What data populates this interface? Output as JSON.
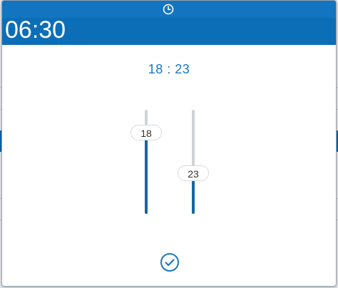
{
  "header": {
    "clock_icon": "clock-icon",
    "time": "06:30"
  },
  "picker": {
    "selected_time": "18 : 23",
    "hour": {
      "label": "18",
      "value": 18,
      "max": 23
    },
    "minute": {
      "label": "23",
      "value": 23,
      "max": 59
    }
  },
  "confirm": {
    "icon": "check-circle-icon"
  },
  "colors": {
    "accent": "#0d6eb8",
    "track": "#cfd3d6",
    "fill": "#1366a8"
  }
}
